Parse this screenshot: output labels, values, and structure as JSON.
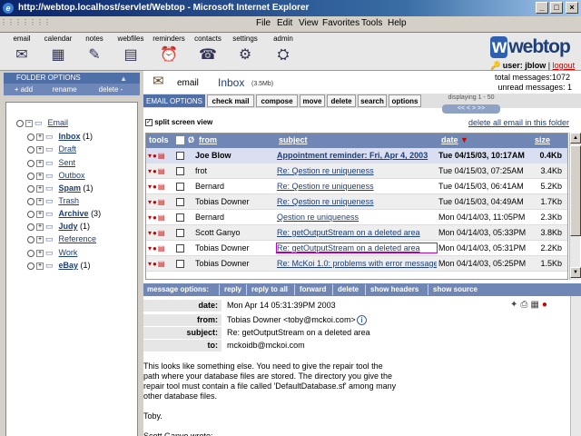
{
  "window": {
    "title": "http://webtop.localhost/servlet/Webtop - Microsoft Internet Explorer"
  },
  "menu": [
    "File",
    "Edit",
    "View",
    "Favorites",
    "Tools",
    "Help"
  ],
  "toolbar": [
    {
      "label": "email",
      "icon": "envelope-icon"
    },
    {
      "label": "calendar",
      "icon": "calendar-icon"
    },
    {
      "label": "notes",
      "icon": "notes-icon"
    },
    {
      "label": "webfiles",
      "icon": "webfiles-icon"
    },
    {
      "label": "reminders",
      "icon": "reminders-icon"
    },
    {
      "label": "contacts",
      "icon": "contacts-icon"
    },
    {
      "label": "settings",
      "icon": "settings-icon"
    },
    {
      "label": "admin",
      "icon": "admin-icon"
    }
  ],
  "logo": "webtop",
  "user": {
    "prefix": "user: ",
    "name": "jblow",
    "sep": " | ",
    "logout": "logout"
  },
  "folders_panel": {
    "header": "FOLDER OPTIONS",
    "buttons": [
      "+ add",
      "rename",
      "delete -"
    ],
    "root": "Email",
    "items": [
      {
        "name": "Inbox",
        "count": "(1)",
        "bold": true
      },
      {
        "name": "Draft",
        "count": ""
      },
      {
        "name": "Sent",
        "count": ""
      },
      {
        "name": "Outbox",
        "count": ""
      },
      {
        "name": "Spam",
        "count": "(1)",
        "bold": true
      },
      {
        "name": "Trash",
        "count": ""
      },
      {
        "name": "Archive",
        "count": "(3)",
        "bold": true
      },
      {
        "name": "Judy",
        "count": "(1)",
        "bold": true
      },
      {
        "name": "Reference",
        "count": ""
      },
      {
        "name": "Work",
        "count": ""
      },
      {
        "name": "eBay",
        "count": "(1)",
        "bold": true
      }
    ]
  },
  "mailbox": {
    "app_label": "email",
    "folder": "Inbox",
    "size": "(3.5Mb)",
    "total": "total messages:1072",
    "unread": "unread messages: 1"
  },
  "tabs": [
    "EMAIL OPTIONS",
    "check mail",
    "compose",
    "move",
    "delete",
    "search",
    "options"
  ],
  "paging": {
    "text": "displaying 1 - 50",
    "buttons": "<< < > >>"
  },
  "split_screen": "split screen view",
  "delete_all": "delete all email in this folder",
  "columns": {
    "tools": "tools",
    "from": "from",
    "subject": "subject",
    "date": "date",
    "size": "size"
  },
  "messages": [
    {
      "from": "Joe Blow",
      "subject": "Appointment reminder: Fri, Apr 4, 2003",
      "date": "Tue 04/15/03, 10:17AM",
      "size": "0.4Kb",
      "unread": true
    },
    {
      "from": "frot",
      "subject": "Re: Qestion re uniqueness",
      "date": "Tue 04/15/03, 07:25AM",
      "size": "3.4Kb"
    },
    {
      "from": "Bernard",
      "subject": "Re: Qestion re uniqueness",
      "date": "Tue 04/15/03, 06:41AM",
      "size": "5.2Kb"
    },
    {
      "from": "Tobias Downer",
      "subject": "Re: Qestion re uniqueness",
      "date": "Tue 04/15/03, 04:49AM",
      "size": "1.7Kb"
    },
    {
      "from": "Bernard",
      "subject": "Qestion re uniqueness",
      "date": "Mon 04/14/03, 11:05PM",
      "size": "2.3Kb"
    },
    {
      "from": "Scott Ganyo",
      "subject": "Re: getOutputStream on a deleted area",
      "date": "Mon 04/14/03, 05:33PM",
      "size": "3.8Kb"
    },
    {
      "from": "Tobias Downer",
      "subject": "Re: getOutputStream on a deleted area",
      "date": "Mon 04/14/03, 05:31PM",
      "size": "2.2Kb",
      "selected": true
    },
    {
      "from": "Tobias Downer",
      "subject": "Re: McKoi 1.0: problems with error messages...",
      "date": "Mon 04/14/03, 05:25PM",
      "size": "1.5Kb"
    }
  ],
  "message_options": [
    "message options:",
    "reply",
    "reply to all",
    "forward",
    "delete",
    "show headers",
    "show source"
  ],
  "message": {
    "date_label": "date:",
    "date": "Mon Apr 14 05:31:39PM 2003",
    "from_label": "from:",
    "from": "Tobias Downer <toby@mckoi.com>",
    "subject_label": "subject:",
    "subject": "Re: getOutputStream on a deleted area",
    "to_label": "to:",
    "to": "mckoidb@mckoi.com",
    "body": "This looks like something else. You need to give the repair tool the\npath where your database files are stored. The directory you give the\nrepair tool must contain a file called 'DefaultDatabase.sf' among many\nother database files.\n\nToby.\n\nScott Ganyo wrote:"
  },
  "colors": {
    "accent": "#4f6fa8",
    "header": "#7087b5",
    "link": "#1c3e7a"
  }
}
